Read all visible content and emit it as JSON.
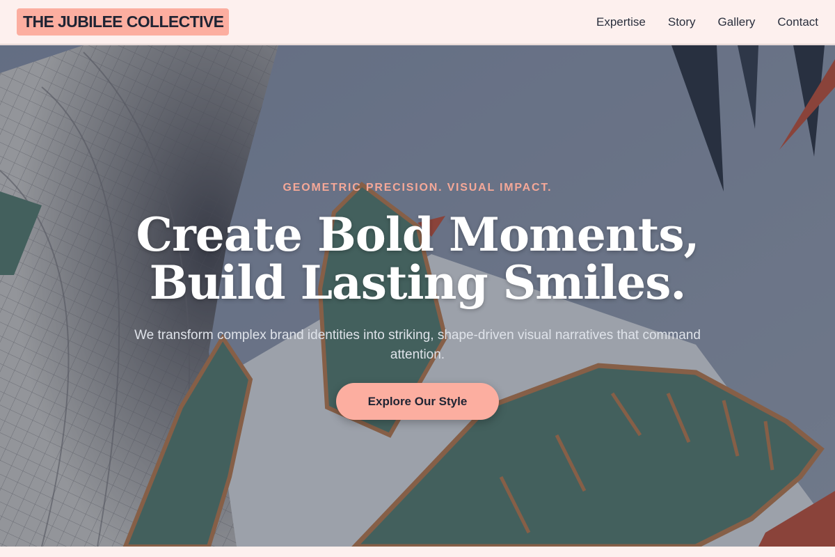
{
  "header": {
    "logo": "THE JUBILEE COLLECTIVE",
    "nav": [
      "Expertise",
      "Story",
      "Gallery",
      "Contact"
    ]
  },
  "hero": {
    "eyebrow": "GEOMETRIC PRECISION. VISUAL IMPACT.",
    "headline_line1": "Create Bold Moments,",
    "headline_line2": "Build Lasting Smiles.",
    "subtitle": "We transform complex brand identities into striking, shape-driven visual narratives that command attention.",
    "cta_label": "Explore Our Style"
  },
  "colors": {
    "accent": "#fcaea0",
    "header_bg": "#fdf0ee",
    "eyebrow": "#f5a898",
    "leaf_green": "#4f7c6c",
    "leaf_outline": "#c17b46"
  }
}
